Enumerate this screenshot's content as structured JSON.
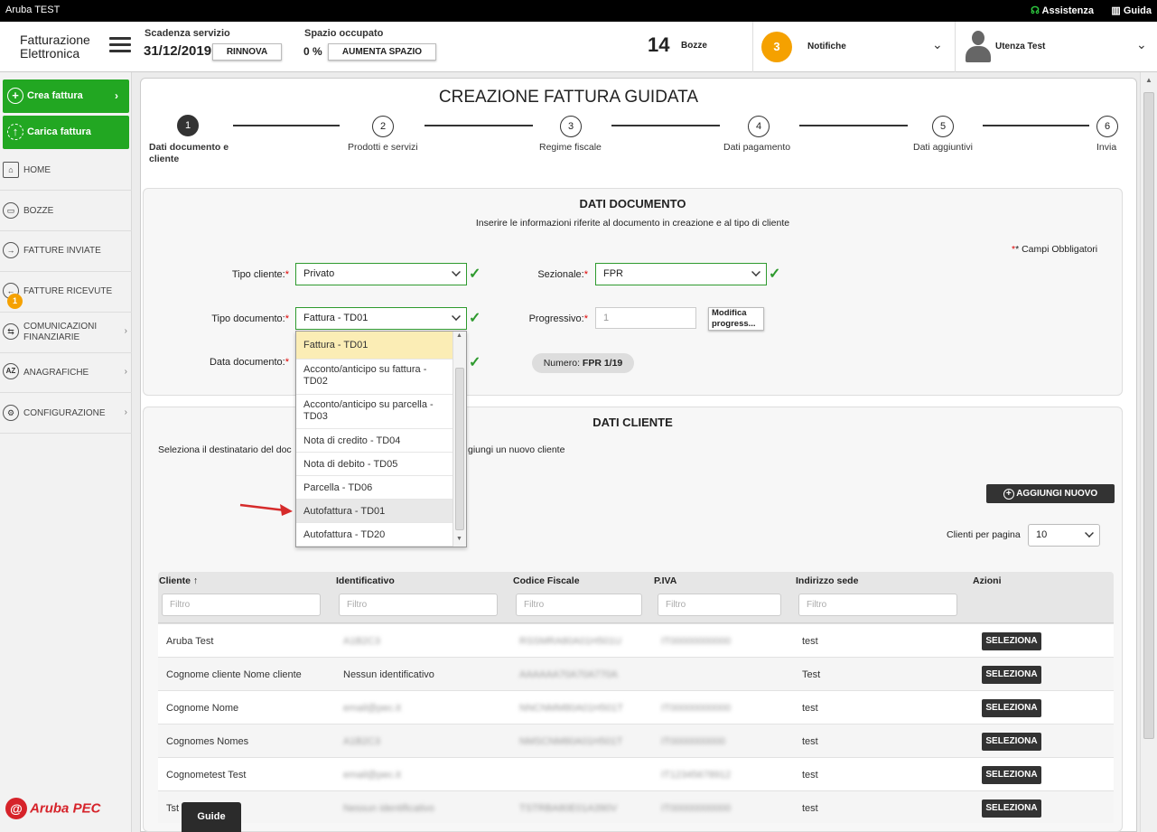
{
  "window": {
    "title": "Aruba TEST",
    "assistenza": "Assistenza",
    "guida": "Guida"
  },
  "header": {
    "logo_line1": "Fatturazione",
    "logo_line2": "Elettronica",
    "scadenza_label": "Scadenza servizio",
    "scadenza_value": "31/12/2019",
    "rinnova": "RINNOVA",
    "spazio_label": "Spazio occupato",
    "spazio_value": "0 %",
    "aumenta": "AUMENTA SPAZIO",
    "bozze_count": "14",
    "bozze_label": "Bozze",
    "notifiche_count": "3",
    "notifiche_label": "Notifiche",
    "user": "Utenza Test"
  },
  "sidebar": {
    "crea": "Crea fattura",
    "carica": "Carica fattura",
    "items": [
      {
        "label": "HOME"
      },
      {
        "label": "BOZZE"
      },
      {
        "label": "FATTURE INVIATE"
      },
      {
        "label": "FATTURE RICEVUTE",
        "badge": "1"
      },
      {
        "label1": "COMUNICAZIONI",
        "label2": "FINANZIARIE"
      },
      {
        "label": "ANAGRAFICHE"
      },
      {
        "label": "CONFIGURAZIONE"
      }
    ],
    "brand": "Aruba PEC"
  },
  "page": {
    "title": "CREAZIONE FATTURA GUIDATA",
    "steps": [
      {
        "n": "1",
        "label1": "Dati documento e",
        "label2": "cliente"
      },
      {
        "n": "2",
        "label": "Prodotti e servizi"
      },
      {
        "n": "3",
        "label": "Regime fiscale"
      },
      {
        "n": "4",
        "label": "Dati pagamento"
      },
      {
        "n": "5",
        "label": "Dati aggiuntivi"
      },
      {
        "n": "6",
        "label": "Invia"
      }
    ]
  },
  "dati_documento": {
    "title": "DATI DOCUMENTO",
    "subtitle": "Inserire le informazioni riferite al documento in creazione e al tipo di cliente",
    "obbligatori": "* Campi Obbligatori",
    "tipo_cliente_label": "Tipo cliente:",
    "tipo_cliente_value": "Privato",
    "sezionale_label": "Sezionale:",
    "sezionale_value": "FPR",
    "tipo_documento_label": "Tipo documento:",
    "tipo_documento_value": "Fattura - TD01",
    "progressivo_label": "Progressivo:",
    "progressivo_placeholder": "1",
    "modifica_line1": "Modifica",
    "modifica_line2": "progress...",
    "data_documento_label": "Data documento:",
    "numero_label": "Numero:",
    "numero_value": "FPR 1/19",
    "options": [
      {
        "l1": "Fattura - TD01"
      },
      {
        "l1": "Acconto/anticipo su fattura -",
        "l2": "TD02"
      },
      {
        "l1": "Acconto/anticipo su parcella -",
        "l2": "TD03"
      },
      {
        "l1": "Nota di credito - TD04"
      },
      {
        "l1": "Nota di debito - TD05"
      },
      {
        "l1": "Parcella - TD06"
      },
      {
        "l1": "Autofattura - TD01"
      },
      {
        "l1": "Autofattura - TD20"
      }
    ]
  },
  "dati_cliente": {
    "title": "DATI CLIENTE",
    "instr_left": "Seleziona il destinatario del doc",
    "instr_right": "giungi un nuovo cliente",
    "aggiungi": "AGGIUNGI NUOVO",
    "clienti_per_pagina": "Clienti per pagina",
    "per_pagina_value": "10",
    "columns": [
      "Cliente ↑",
      "Identificativo",
      "Codice Fiscale",
      "P.IVA",
      "Indirizzo sede",
      "Azioni"
    ],
    "filter_placeholder": "Filtro",
    "rows": [
      {
        "cliente": "Aruba Test",
        "id": "A1B2C3",
        "cf": "RSSMRA80A01H501U",
        "piva": "IT00000000000",
        "sede": "test"
      },
      {
        "cliente": "Cognome cliente Nome cliente",
        "id": "Nessun identificativo",
        "cf": "AAAAAA70A70A770A",
        "piva": "",
        "sede": "Test"
      },
      {
        "cliente": "Cognome Nome",
        "id": "email@pec.it",
        "cf": "NNCNMM80A01H501T",
        "piva": "IT00000000000",
        "sede": "test"
      },
      {
        "cliente": "Cognomes Nomes",
        "id": "A1B2C3",
        "cf": "NMSCNM80A01H501T",
        "piva": "IT0000000000",
        "sede": "test"
      },
      {
        "cliente": "Cognometest Test",
        "id": "email@pec.it",
        "cf": "",
        "piva": "IT12345678912",
        "sede": "test"
      },
      {
        "cliente": "Tst",
        "id": "Nessun identificativo",
        "cf": "TSTRBA80E01A390V",
        "piva": "IT00000000000",
        "sede": "test"
      }
    ],
    "seleziona": "SELEZIONA"
  },
  "guide_tab": "Guide",
  "colors": {
    "green": "#22a722",
    "orange": "#f5a100",
    "dark": "#333333"
  }
}
